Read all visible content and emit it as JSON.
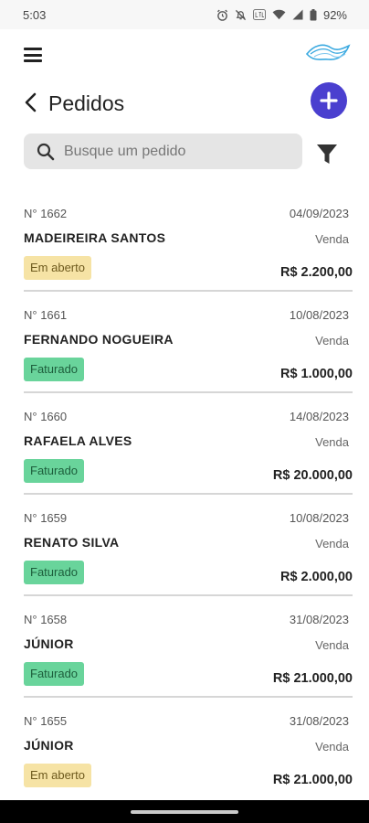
{
  "status_bar": {
    "time": "5:03",
    "battery": "92%"
  },
  "header": {
    "menu_icon": "hamburger-menu-icon",
    "logo_icon": "brand-logo-icon"
  },
  "page": {
    "title": "Pedidos",
    "back_icon": "chevron-left-icon",
    "add_icon": "plus-icon"
  },
  "search": {
    "placeholder": "Busque um pedido",
    "value": "",
    "filter_icon": "filter-icon"
  },
  "colors": {
    "accent": "#4a3fcf",
    "status_open_bg": "#f6e3a5",
    "status_billed_bg": "#69d49b"
  },
  "orders": [
    {
      "number": "N° 1662",
      "date": "04/09/2023",
      "client": "MADEIREIRA SANTOS",
      "type": "Venda",
      "status": "Em aberto",
      "status_kind": "open",
      "total": "R$ 2.200,00"
    },
    {
      "number": "N° 1661",
      "date": "10/08/2023",
      "client": "FERNANDO NOGUEIRA",
      "type": "Venda",
      "status": "Faturado",
      "status_kind": "billed",
      "total": "R$ 1.000,00"
    },
    {
      "number": "N° 1660",
      "date": "14/08/2023",
      "client": "RAFAELA ALVES",
      "type": "Venda",
      "status": "Faturado",
      "status_kind": "billed",
      "total": "R$ 20.000,00"
    },
    {
      "number": "N° 1659",
      "date": "10/08/2023",
      "client": "RENATO SILVA",
      "type": "Venda",
      "status": "Faturado",
      "status_kind": "billed",
      "total": "R$ 2.000,00"
    },
    {
      "number": "N° 1658",
      "date": "31/08/2023",
      "client": "JÚNIOR",
      "type": "Venda",
      "status": "Faturado",
      "status_kind": "billed",
      "total": "R$ 21.000,00"
    },
    {
      "number": "N° 1655",
      "date": "31/08/2023",
      "client": "JÚNIOR",
      "type": "Venda",
      "status": "Em aberto",
      "status_kind": "open",
      "total": "R$ 21.000,00"
    }
  ]
}
